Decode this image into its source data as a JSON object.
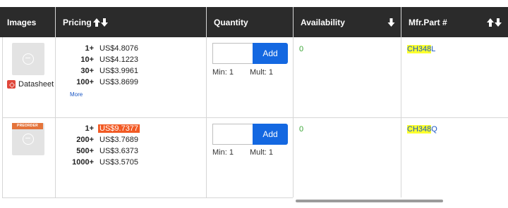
{
  "table": {
    "headers": {
      "images": "Images",
      "pricing": "Pricing",
      "quantity": "Quantity",
      "availability": "Availability",
      "mfr_part": "Mfr.Part #"
    },
    "rows": [
      {
        "preorder": "",
        "datasheet": "Datasheet",
        "prices": [
          {
            "qty": "1+",
            "price": "US$4.8076"
          },
          {
            "qty": "10+",
            "price": "US$4.1223"
          },
          {
            "qty": "30+",
            "price": "US$3.9961"
          },
          {
            "qty": "100+",
            "price": "US$3.8699"
          }
        ],
        "more": "More",
        "add_label": "Add",
        "min": "Min: 1",
        "mult": "Mult: 1",
        "availability": "0",
        "mfr_highlight": "CH348",
        "mfr_rest": "L"
      },
      {
        "preorder": "PREORDER",
        "datasheet": "",
        "prices": [
          {
            "qty": "1+",
            "price": "US$9.7377"
          },
          {
            "qty": "200+",
            "price": "US$3.7689"
          },
          {
            "qty": "500+",
            "price": "US$3.6373"
          },
          {
            "qty": "1000+",
            "price": "US$3.5705"
          }
        ],
        "more": "",
        "add_label": "Add",
        "min": "Min: 1",
        "mult": "Mult: 1",
        "availability": "0",
        "mfr_highlight": "CH348",
        "mfr_rest": "Q"
      }
    ]
  },
  "colors": {
    "header_bg": "#2b2b2b",
    "add_button": "#1468e1",
    "availability": "#3aa535",
    "link": "#1a56c4",
    "search_highlight": "#fbff2e",
    "price_highlight": "#f25a24",
    "preorder_badge": "#e4743b"
  },
  "icons": {
    "sort": "sort-up-down-icon",
    "sort_down": "sort-down-icon",
    "pdf": "pdf-icon",
    "product_placeholder": "product-placeholder-icon"
  }
}
